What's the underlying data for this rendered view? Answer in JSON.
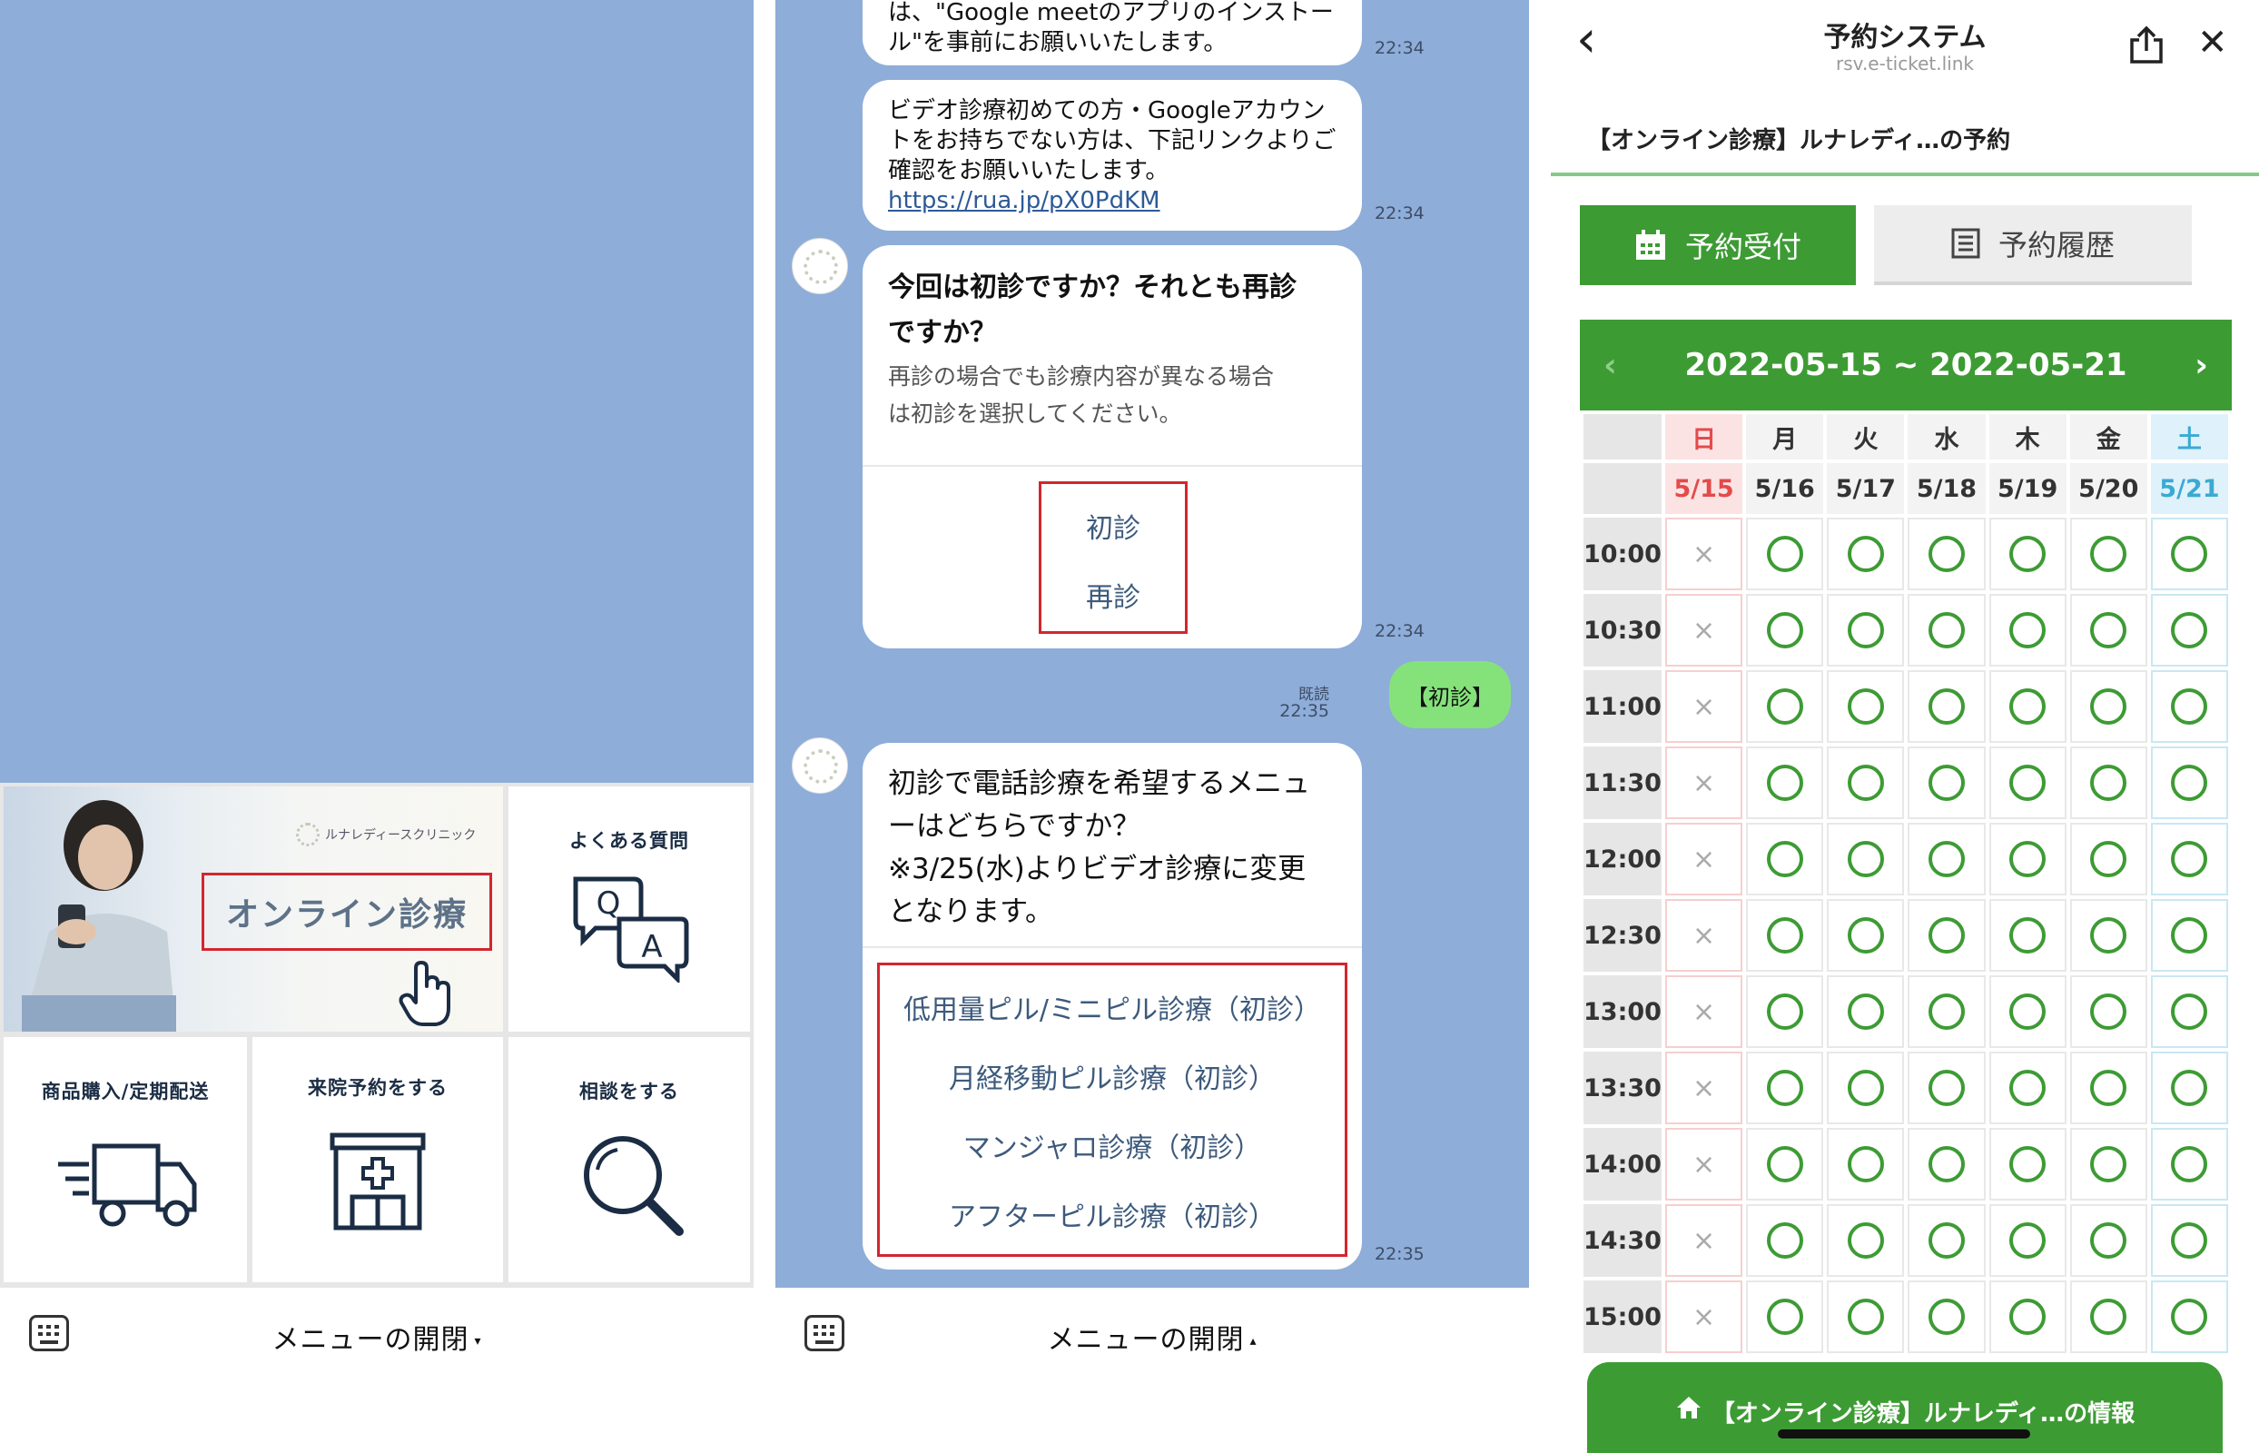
{
  "panel1": {
    "rich_menu": {
      "hero_logo": "ルナレディースクリニック",
      "hero_title": "オンライン診療",
      "faq_label": "よくある質問",
      "shop_label": "商品購入/定期配送",
      "visit_label": "来院予約をする",
      "consult_label": "相談をする"
    },
    "footer": {
      "menu_toggle": "メニューの開閉",
      "arrow": "▾"
    }
  },
  "panel2": {
    "messages": [
      {
        "text_line1": "は、\"Google meetのアプリのインストー",
        "text_line2": "ル\"を事前にお願いいたします。",
        "time": "22:34"
      },
      {
        "line1": "ビデオ診療初めての方・Googleアカウン",
        "line2": "トをお持ちでない方は、下記リンクよりご",
        "line3": "確認をお願いいたします。",
        "link": "https://rua.jp/pX0PdKM",
        "time": "22:34"
      }
    ],
    "question1": {
      "title_line1": "今回は初診ですか？それとも再診",
      "title_line2": "ですか？",
      "body_line1": "再診の場合でも診療内容が異なる場合",
      "body_line2": "は初診を選択してください。",
      "options": [
        "初診",
        "再診"
      ],
      "time": "22:34"
    },
    "sent_message": {
      "read": "既読",
      "time": "22:35",
      "text": "【初診】"
    },
    "question2": {
      "line1": "初診で電話診療を希望するメニュ",
      "line2": "ーはどちらですか？",
      "line3": "※3/25(水)よりビデオ診療に変更",
      "line4": "となります。",
      "options": [
        "低用量ピル/ミニピル診療（初診）",
        "月経移動ピル診療（初診）",
        "マンジャロ診療（初診）",
        "アフターピル診療（初診）"
      ],
      "time": "22:35"
    },
    "footer": {
      "menu_toggle": "メニューの開閉",
      "arrow": "▴"
    }
  },
  "panel3": {
    "nav": {
      "title": "予約システム",
      "url": "rsv.e-ticket.link",
      "back": "‹",
      "close": "✕"
    },
    "heading": "【オンライン診療】ルナレディ…の予約",
    "tabs": {
      "reserve": "予約受付",
      "history": "予約履歴"
    },
    "week_range": "2022-05-15 ~ 2022-05-21",
    "days": [
      "日",
      "月",
      "火",
      "水",
      "木",
      "金",
      "土"
    ],
    "dates": [
      "5/15",
      "5/16",
      "5/17",
      "5/18",
      "5/19",
      "5/20",
      "5/21"
    ],
    "times": [
      "10:00",
      "10:30",
      "11:00",
      "11:30",
      "12:00",
      "12:30",
      "13:00",
      "13:30",
      "14:00",
      "14:30",
      "15:00"
    ],
    "available_mark": "○",
    "unavailable_mark": "×",
    "info_button": "【オンライン診療】ルナレディ…の情報",
    "colors": {
      "accent_green": "#3d9b34",
      "sunday_red": "#e34b4b",
      "saturday_blue": "#3aaad3",
      "highlight_red": "#d3262f"
    }
  }
}
